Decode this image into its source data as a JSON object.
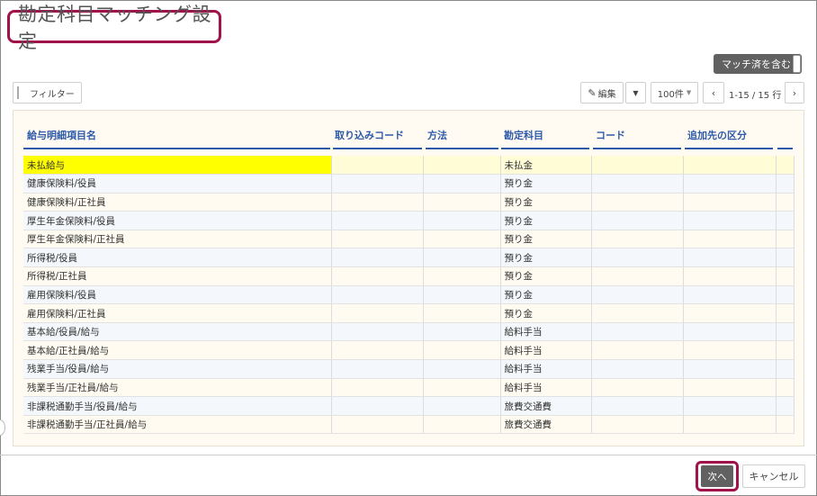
{
  "title": "勘定科目マッチング設定",
  "toggle_label": "マッチ済を含む",
  "toolbar": {
    "filter_label": "フィルター",
    "edit_label": "編集",
    "per_page": "100件",
    "pager_text": "1-15 / 15 行"
  },
  "columns": [
    "給与明細項目名",
    "取り込みコード",
    "方法",
    "勘定科目",
    "コード",
    "追加先の区分"
  ],
  "rows": [
    {
      "name": "未払給与",
      "account": "未払金"
    },
    {
      "name": "健康保険料/役員",
      "account": "預り金"
    },
    {
      "name": "健康保険料/正社員",
      "account": "預り金"
    },
    {
      "name": "厚生年金保険料/役員",
      "account": "預り金"
    },
    {
      "name": "厚生年金保険料/正社員",
      "account": "預り金"
    },
    {
      "name": "所得税/役員",
      "account": "預り金"
    },
    {
      "name": "所得税/正社員",
      "account": "預り金"
    },
    {
      "name": "雇用保険料/役員",
      "account": "預り金"
    },
    {
      "name": "雇用保険料/正社員",
      "account": "預り金"
    },
    {
      "name": "基本給/役員/給与",
      "account": "給料手当"
    },
    {
      "name": "基本給/正社員/給与",
      "account": "給料手当"
    },
    {
      "name": "残業手当/役員/給与",
      "account": "給料手当"
    },
    {
      "name": "残業手当/正社員/給与",
      "account": "給料手当"
    },
    {
      "name": "非課税通勤手当/役員/給与",
      "account": "旅費交通費"
    },
    {
      "name": "非課税通勤手当/正社員/給与",
      "account": "旅費交通費"
    }
  ],
  "footer": {
    "next_label": "次へ",
    "cancel_label": "キャンセル"
  },
  "colors": {
    "accent_border": "#a0134a",
    "header_text": "#2d5aa8",
    "highlight": "#ffff00"
  }
}
